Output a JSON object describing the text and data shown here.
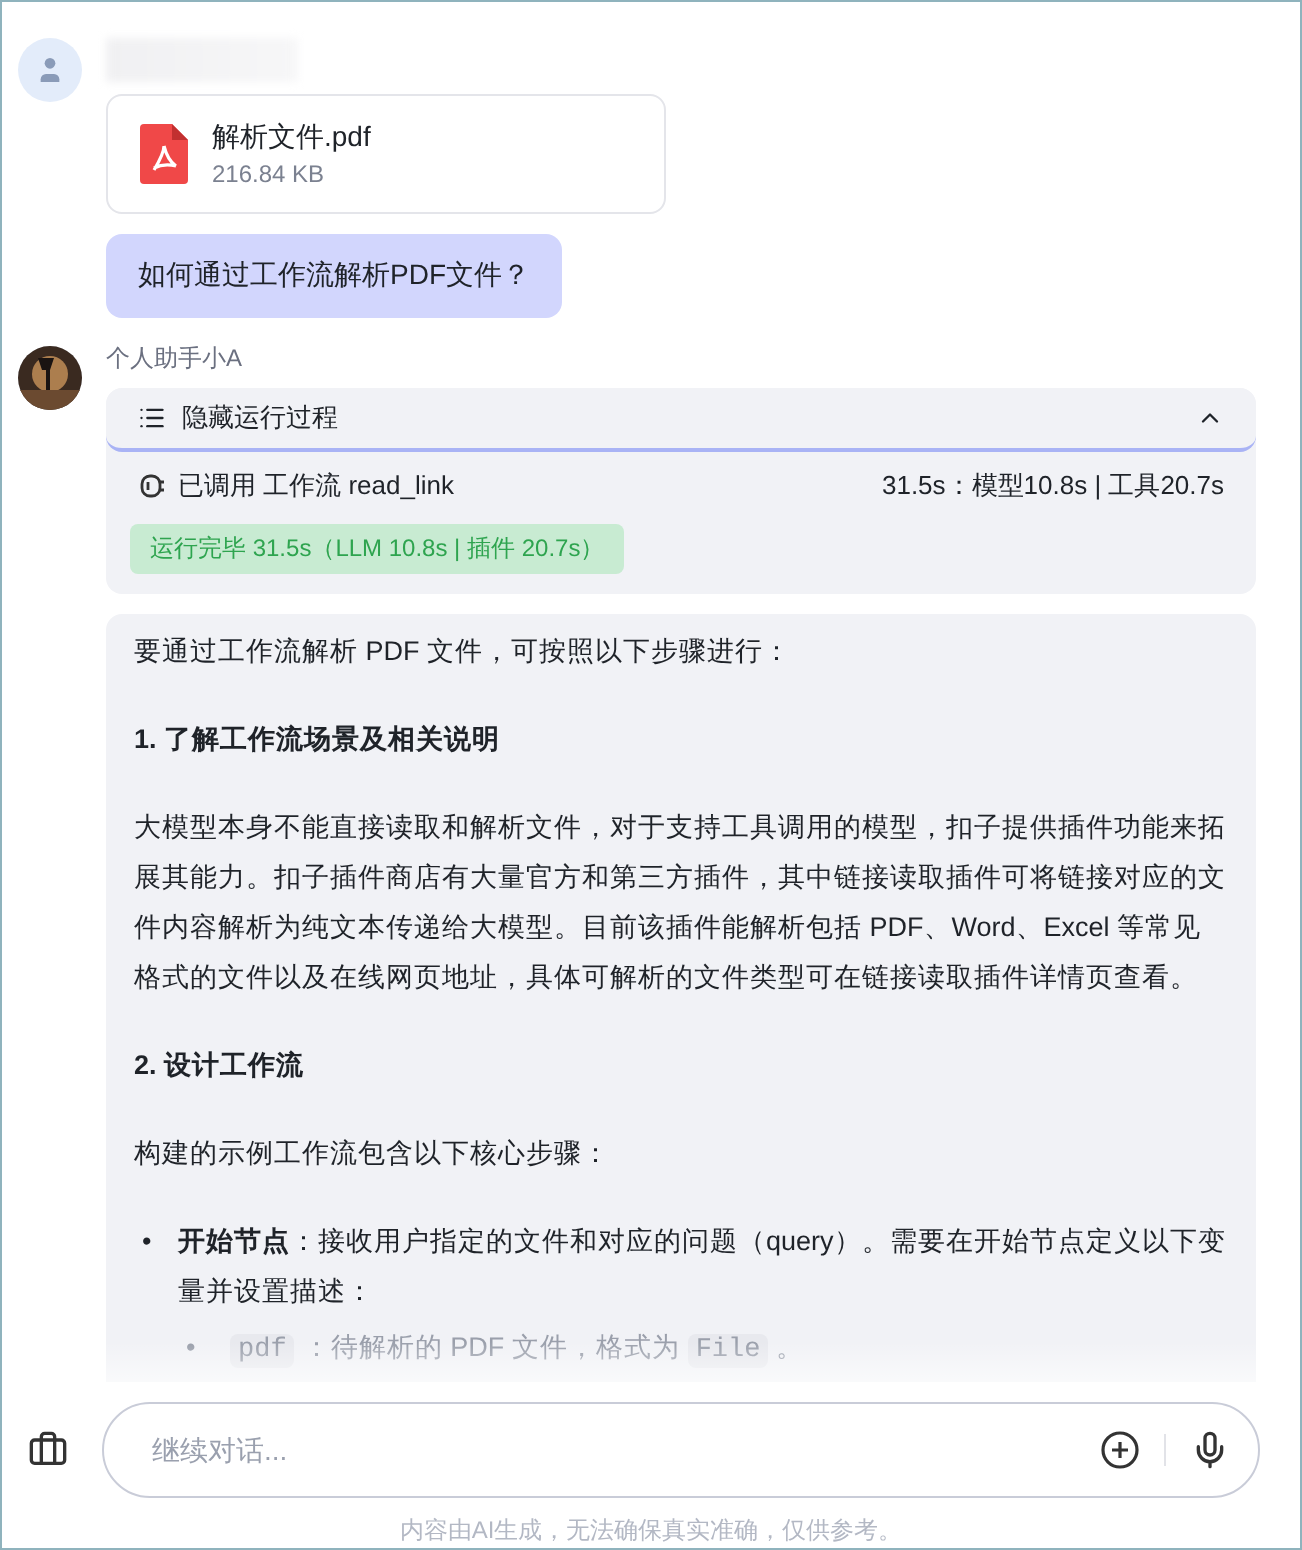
{
  "user_message": {
    "file": {
      "name": "解析文件.pdf",
      "size": "216.84 KB"
    },
    "text": "如何通过工作流解析PDF文件？"
  },
  "bot_message": {
    "name": "个人助手小A",
    "process": {
      "toggle_label": "隐藏运行过程",
      "expanded": true,
      "call_label": "已调用 工作流 read_link",
      "timing": "31.5s：模型10.8s | 工具20.7s",
      "status": "运行完毕 31.5s（LLM 10.8s | 插件 20.7s）"
    },
    "answer": [
      {
        "kind": "paragraph",
        "text": "要通过工作流解析 PDF 文件，可按照以下步骤进行："
      },
      {
        "kind": "heading",
        "text": "1. 了解工作流场景及相关说明"
      },
      {
        "kind": "paragraph",
        "text": "大模型本身不能直接读取和解析文件，对于支持工具调用的模型，扣子提供插件功能来拓展其能力。扣子插件商店有大量官方和第三方插件，其中链接读取插件可将链接对应的文件内容解析为纯文本传递给大模型。目前该插件能解析包括 PDF、Word、Excel 等常见格式的文件以及在线网页地址，具体可解析的文件类型可在链接读取插件详情页查看。"
      },
      {
        "kind": "heading",
        "text": "2. 设计工作流"
      },
      {
        "kind": "paragraph",
        "text": "构建的示例工作流包含以下核心步骤："
      },
      {
        "kind": "bullet",
        "marker": "•",
        "text": "**开始节点**：接收用户指定的文件和对应的问题（query）。需要在开始节点定义以下变量并设置描述：",
        "children": [
          {
            "marker": "•",
            "parts": [
              {
                "kind": "code",
                "text": "pdf"
              },
              {
                "kind": "text",
                "text": "：待解析的 PDF 文件，格式为"
              },
              {
                "kind": "code",
                "text": "File"
              },
              {
                "kind": "text",
                "text": "。"
              }
            ]
          }
        ]
      }
    ]
  },
  "composer": {
    "placeholder": "继续对话..."
  },
  "disclaimer": "内容由AI生成，无法确保真实准确，仅供参考。"
}
